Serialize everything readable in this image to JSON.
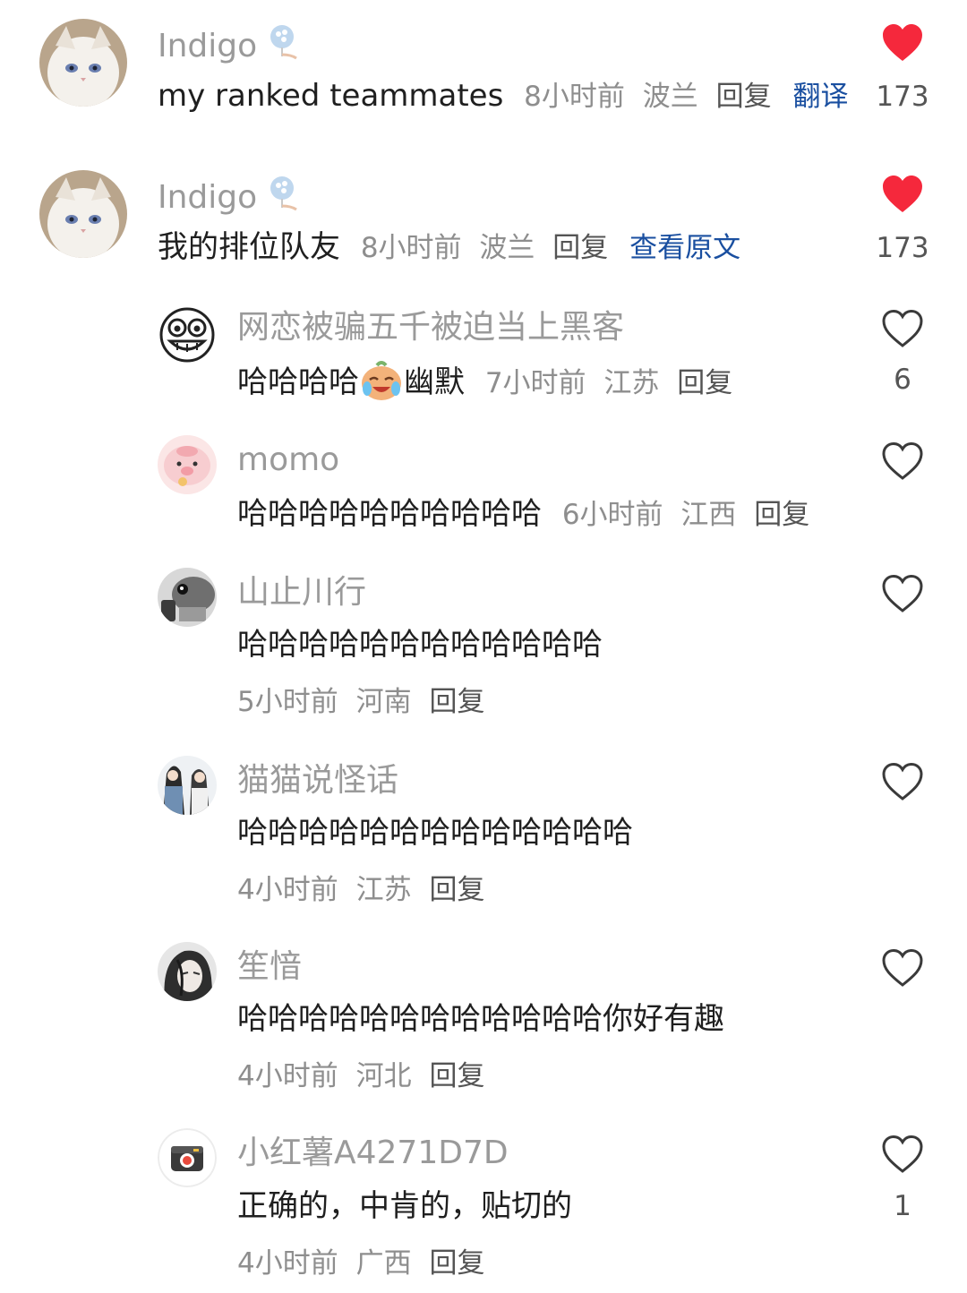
{
  "comments": [
    {
      "username": "Indigo",
      "text": "my ranked teammates",
      "time": "8小时前",
      "location": "波兰",
      "reply": "回复",
      "extra_link": "翻译",
      "likes": "173",
      "liked": true
    },
    {
      "username": "Indigo",
      "text": "我的排位队友",
      "time": "8小时前",
      "location": "波兰",
      "reply": "回复",
      "extra_link": "查看原文",
      "likes": "173",
      "liked": true
    }
  ],
  "replies": [
    {
      "username": "网恋被骗五千被迫当上黑客",
      "text_before": "哈哈哈哈",
      "emoji": "crying-laughing-emoji",
      "text_after": "幽默",
      "time": "7小时前",
      "location": "江苏",
      "reply": "回复",
      "likes": "6"
    },
    {
      "username": "momo",
      "text": "哈哈哈哈哈哈哈哈哈哈",
      "time": "6小时前",
      "location": "江西",
      "reply": "回复",
      "likes": ""
    },
    {
      "username": "山止川行",
      "text": "哈哈哈哈哈哈哈哈哈哈哈哈",
      "time": "5小时前",
      "location": "河南",
      "reply": "回复",
      "likes": ""
    },
    {
      "username": "猫猫说怪话",
      "text": "哈哈哈哈哈哈哈哈哈哈哈哈哈",
      "time": "4小时前",
      "location": "江苏",
      "reply": "回复",
      "likes": ""
    },
    {
      "username": "笙愔",
      "text": "哈哈哈哈哈哈哈哈哈哈哈哈你好有趣",
      "time": "4小时前",
      "location": "河北",
      "reply": "回复",
      "likes": ""
    },
    {
      "username": "小红薯A4271D7D",
      "text": "正确的，中肯的，贴切的",
      "time": "4小时前",
      "location": "广西",
      "reply": "回复",
      "likes": "1"
    }
  ],
  "icons": {
    "liked_heart": "heart-filled-icon",
    "unliked_heart": "heart-outline-icon",
    "badge": "flower-badge-icon"
  },
  "colors": {
    "liked_heart": "#f5283c",
    "link_blue": "#1a4fa0",
    "meta_gray": "#8e8e8e",
    "username_gray": "#9a9a9a"
  }
}
